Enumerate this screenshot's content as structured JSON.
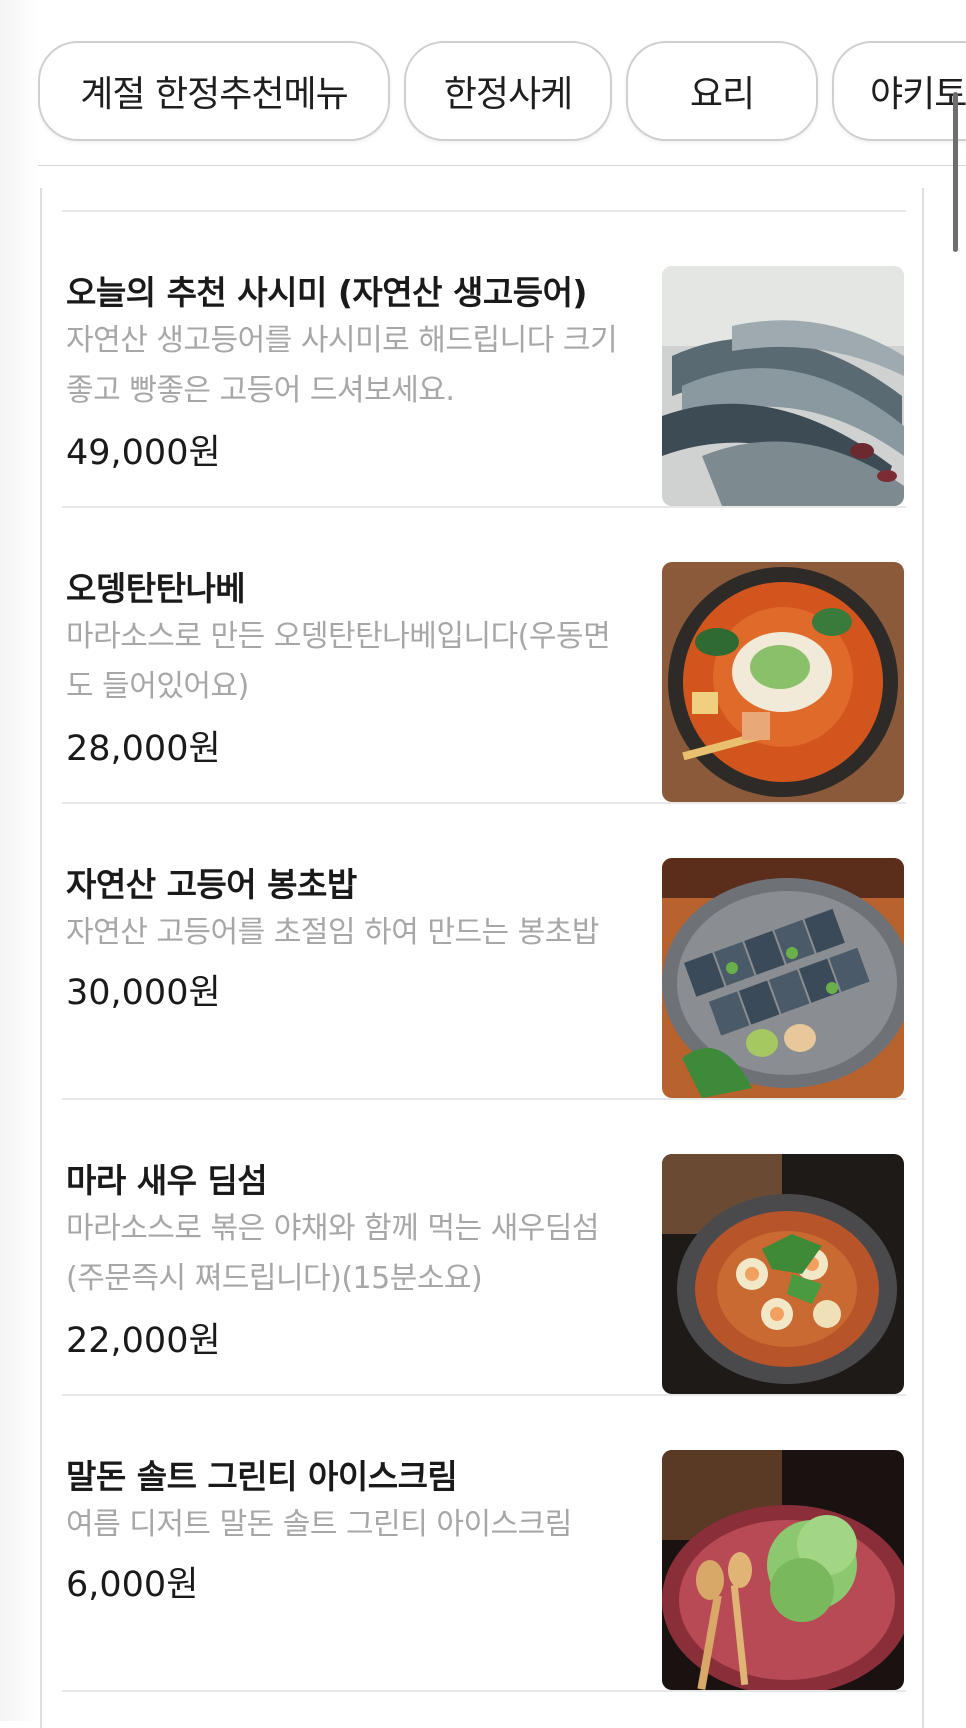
{
  "tabs": [
    {
      "label": "계절 한정추천메뉴"
    },
    {
      "label": "한정사케"
    },
    {
      "label": "요리"
    },
    {
      "label": "야키토"
    }
  ],
  "menu": {
    "items": [
      {
        "name": "오늘의 추천 사시미 (자연산 생고등어)",
        "desc_lines": [
          "자연산 생고등어를 사시미로 해드립니다 크기",
          "좋고 빵좋은 고등어 드셔보세요."
        ],
        "price": "49,000원",
        "photo_icon": "mackerel-fish-photo"
      },
      {
        "name": "오뎅탄탄나베",
        "desc_lines": [
          "마라소스로 만든 오뎅탄탄나베입니다(우동면",
          "도 들어있어요)"
        ],
        "price": "28,000원",
        "photo_icon": "spicy-hotpot-photo"
      },
      {
        "name": "자연산 고등어 봉초밥",
        "desc_lines": [
          "자연산 고등어를 초절임 하여 만드는 봉초밥"
        ],
        "price": "30,000원",
        "photo_icon": "mackerel-sushi-photo"
      },
      {
        "name": "마라 새우 딤섬",
        "desc_lines": [
          "마라소스로 볶은 야채와 함께 먹는 새우딤섬",
          "(주문즉시 쪄드립니다)(15분소요)"
        ],
        "price": "22,000원",
        "photo_icon": "shrimp-dimsum-photo"
      },
      {
        "name": "말돈 솔트 그린티 아이스크림",
        "desc_lines": [
          "여름 디저트 말돈 솔트 그린티 아이스크림"
        ],
        "price": "6,000원",
        "photo_icon": "greentea-icecream-photo"
      }
    ]
  },
  "colors": {
    "text_primary": "#1a1a1a",
    "text_secondary": "#a7a7a7",
    "divider": "#e8e8e8",
    "tab_border": "#cfcfcf"
  }
}
